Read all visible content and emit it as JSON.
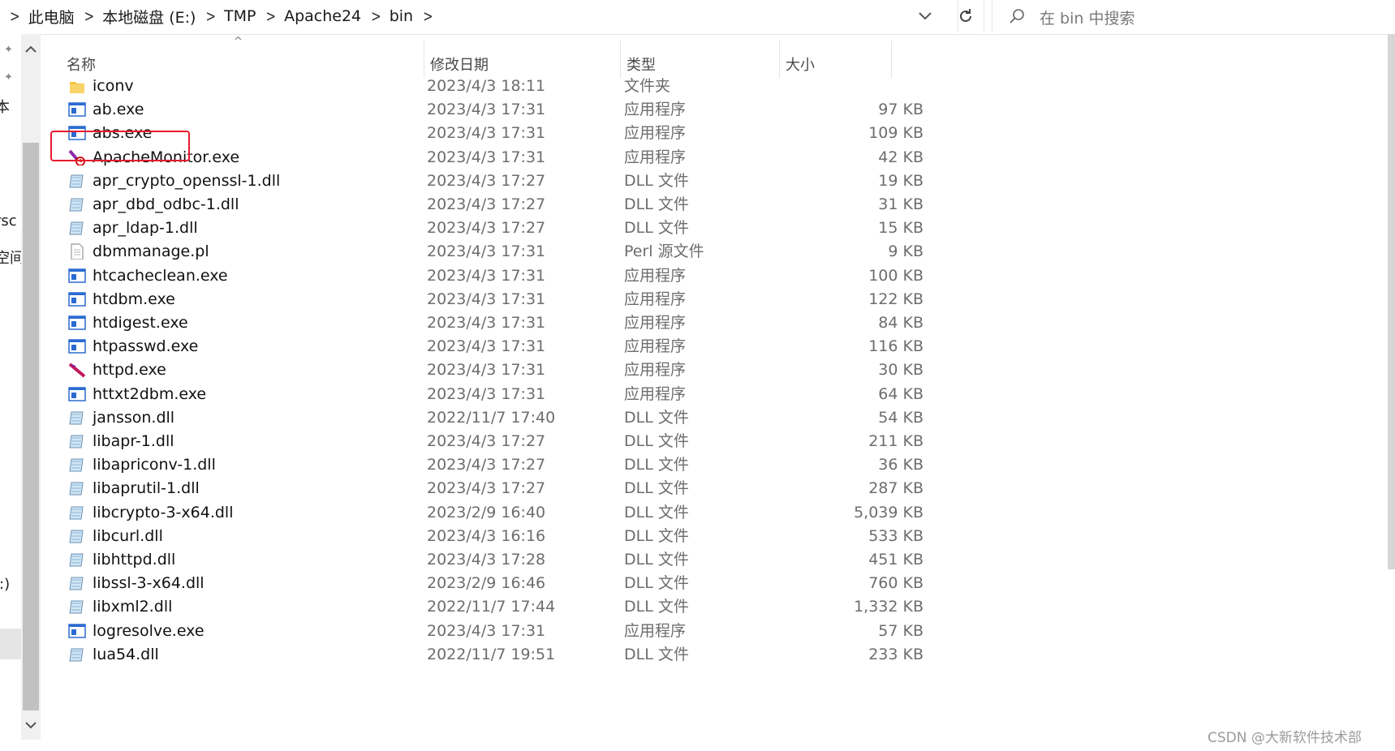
{
  "breadcrumb": [
    "此电脑",
    "本地磁盘 (E:)",
    "TMP",
    "Apache24",
    "bin"
  ],
  "search": {
    "placeholder": "在 bin 中搜索"
  },
  "nav_partial": [
    "本",
    "rsc",
    "空间",
    "l:)"
  ],
  "columns": {
    "name": "名称",
    "date": "修改日期",
    "type": "类型",
    "size": "大小"
  },
  "files": [
    {
      "name": "iconv",
      "date": "2023/4/3 18:11",
      "type": "文件夹",
      "size": "",
      "icon": "folder-icon"
    },
    {
      "name": "ab.exe",
      "date": "2023/4/3 17:31",
      "type": "应用程序",
      "size": "97 KB",
      "icon": "exe-icon"
    },
    {
      "name": "abs.exe",
      "date": "2023/4/3 17:31",
      "type": "应用程序",
      "size": "109 KB",
      "icon": "exe-icon"
    },
    {
      "name": "ApacheMonitor.exe",
      "date": "2023/4/3 17:31",
      "type": "应用程序",
      "size": "42 KB",
      "icon": "apache-monitor-icon"
    },
    {
      "name": "apr_crypto_openssl-1.dll",
      "date": "2023/4/3 17:27",
      "type": "DLL 文件",
      "size": "19 KB",
      "icon": "dll-icon"
    },
    {
      "name": "apr_dbd_odbc-1.dll",
      "date": "2023/4/3 17:27",
      "type": "DLL 文件",
      "size": "31 KB",
      "icon": "dll-icon"
    },
    {
      "name": "apr_ldap-1.dll",
      "date": "2023/4/3 17:27",
      "type": "DLL 文件",
      "size": "15 KB",
      "icon": "dll-icon"
    },
    {
      "name": "dbmmanage.pl",
      "date": "2023/4/3 17:31",
      "type": "Perl 源文件",
      "size": "9 KB",
      "icon": "text-file-icon"
    },
    {
      "name": "htcacheclean.exe",
      "date": "2023/4/3 17:31",
      "type": "应用程序",
      "size": "100 KB",
      "icon": "exe-icon"
    },
    {
      "name": "htdbm.exe",
      "date": "2023/4/3 17:31",
      "type": "应用程序",
      "size": "122 KB",
      "icon": "exe-icon"
    },
    {
      "name": "htdigest.exe",
      "date": "2023/4/3 17:31",
      "type": "应用程序",
      "size": "84 KB",
      "icon": "exe-icon"
    },
    {
      "name": "htpasswd.exe",
      "date": "2023/4/3 17:31",
      "type": "应用程序",
      "size": "116 KB",
      "icon": "exe-icon"
    },
    {
      "name": "httpd.exe",
      "date": "2023/4/3 17:31",
      "type": "应用程序",
      "size": "30 KB",
      "icon": "apache-feather-icon"
    },
    {
      "name": "httxt2dbm.exe",
      "date": "2023/4/3 17:31",
      "type": "应用程序",
      "size": "64 KB",
      "icon": "exe-icon"
    },
    {
      "name": "jansson.dll",
      "date": "2022/11/7 17:40",
      "type": "DLL 文件",
      "size": "54 KB",
      "icon": "dll-icon"
    },
    {
      "name": "libapr-1.dll",
      "date": "2023/4/3 17:27",
      "type": "DLL 文件",
      "size": "211 KB",
      "icon": "dll-icon"
    },
    {
      "name": "libapriconv-1.dll",
      "date": "2023/4/3 17:27",
      "type": "DLL 文件",
      "size": "36 KB",
      "icon": "dll-icon"
    },
    {
      "name": "libaprutil-1.dll",
      "date": "2023/4/3 17:27",
      "type": "DLL 文件",
      "size": "287 KB",
      "icon": "dll-icon"
    },
    {
      "name": "libcrypto-3-x64.dll",
      "date": "2023/2/9 16:40",
      "type": "DLL 文件",
      "size": "5,039 KB",
      "icon": "dll-icon"
    },
    {
      "name": "libcurl.dll",
      "date": "2023/4/3 16:16",
      "type": "DLL 文件",
      "size": "533 KB",
      "icon": "dll-icon"
    },
    {
      "name": "libhttpd.dll",
      "date": "2023/4/3 17:28",
      "type": "DLL 文件",
      "size": "451 KB",
      "icon": "dll-icon"
    },
    {
      "name": "libssl-3-x64.dll",
      "date": "2023/2/9 16:46",
      "type": "DLL 文件",
      "size": "760 KB",
      "icon": "dll-icon"
    },
    {
      "name": "libxml2.dll",
      "date": "2022/11/7 17:44",
      "type": "DLL 文件",
      "size": "1,332 KB",
      "icon": "dll-icon"
    },
    {
      "name": "logresolve.exe",
      "date": "2023/4/3 17:31",
      "type": "应用程序",
      "size": "57 KB",
      "icon": "exe-icon"
    },
    {
      "name": "lua54.dll",
      "date": "2022/11/7 19:51",
      "type": "DLL 文件",
      "size": "233 KB",
      "icon": "dll-icon"
    }
  ],
  "highlighted_file": "abs.exe",
  "watermark": "CSDN @大新软件技术部",
  "colors": {
    "highlight": "#e8192c",
    "muted_text": "#6d6d6d"
  }
}
